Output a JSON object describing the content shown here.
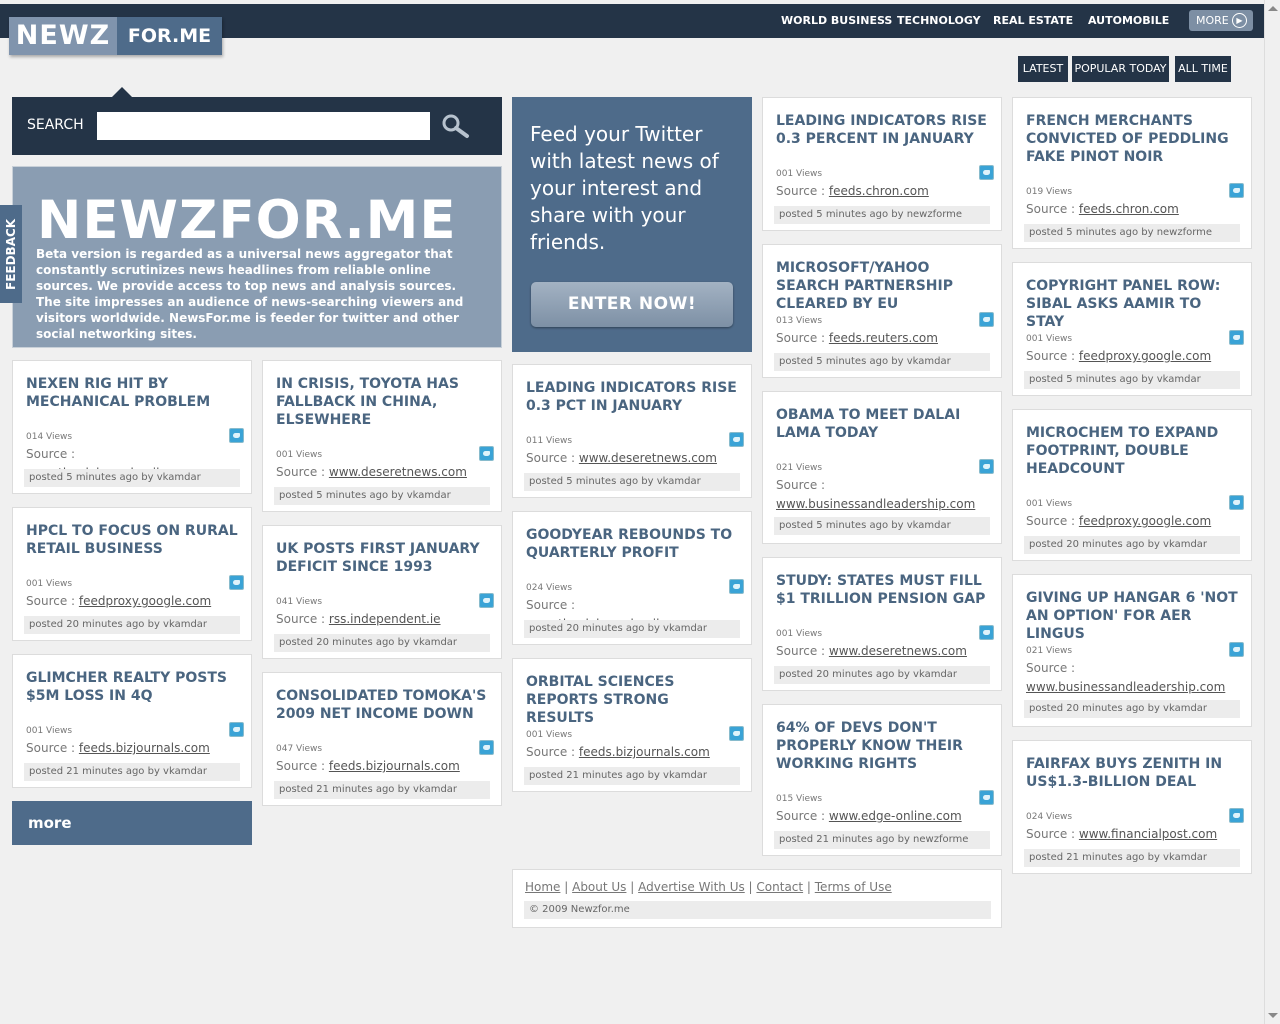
{
  "logo": {
    "part1": "NEWZ",
    "part2": "FOR.ME"
  },
  "nav": {
    "items": [
      "WORLD BUSINESS",
      "TECHNOLOGY",
      "REAL ESTATE",
      "AUTOMOBILE"
    ],
    "more_label": "MORE"
  },
  "filters": [
    "LATEST",
    "POPULAR TODAY",
    "ALL TIME"
  ],
  "search": {
    "label": "SEARCH",
    "placeholder": ""
  },
  "intro": {
    "title": "NEWZFOR.ME",
    "body": "Beta version is regarded as a universal news aggregator that constantly scrutinizes news headlines from reliable online sources. We provide access to top news and analysis sources. The site impresses an audience of news-searching viewers and visitors worldwide. NewsFor.me is feeder for twitter and other social networking sites."
  },
  "feedback_label": "FEEDBACK",
  "promo": {
    "text": "Feed your Twitter with latest news of your interest and share with your friends.",
    "button": "ENTER NOW!"
  },
  "more_panel_label": "more",
  "cards": [
    {
      "title": "NEXEN RIG HIT BY MECHANICAL PROBLEM",
      "views": "014 Views",
      "source_prefix": "Source : ",
      "source": "www.theglobeandmail.com",
      "posted": "posted 5 minutes ago by vkamdar"
    },
    {
      "title": "HPCL TO FOCUS ON RURAL RETAIL BUSINESS",
      "views": "001 Views",
      "source_prefix": "Source : ",
      "source": "feedproxy.google.com",
      "posted": "posted 20 minutes ago by vkamdar"
    },
    {
      "title": "GLIMCHER REALTY POSTS $5M LOSS IN 4Q",
      "views": "001 Views",
      "source_prefix": "Source : ",
      "source": "feeds.bizjournals.com",
      "posted": "posted 21 minutes ago by vkamdar"
    },
    {
      "title": "IN CRISIS, TOYOTA HAS FALLBACK IN CHINA, ELSEWHERE",
      "views": "001 Views",
      "source_prefix": "Source : ",
      "source": "www.deseretnews.com",
      "posted": "posted 5 minutes ago by vkamdar"
    },
    {
      "title": "UK POSTS FIRST JANUARY DEFICIT SINCE 1993",
      "views": "041 Views",
      "source_prefix": "Source : ",
      "source": "rss.independent.ie",
      "posted": "posted 20 minutes ago by vkamdar"
    },
    {
      "title": "CONSOLIDATED TOMOKA'S 2009 NET INCOME DOWN",
      "views": "047 Views",
      "source_prefix": "Source : ",
      "source": "feeds.bizjournals.com",
      "posted": "posted 21 minutes ago by vkamdar"
    },
    {
      "title": "LEADING INDICATORS RISE 0.3 PCT IN JANUARY",
      "views": "011 Views",
      "source_prefix": "Source : ",
      "source": "www.deseretnews.com",
      "posted": "posted 5 minutes ago by vkamdar"
    },
    {
      "title": "GOODYEAR REBOUNDS TO QUARTERLY PROFIT",
      "views": "024 Views",
      "source_prefix": "Source : ",
      "source": "www.theglobeandmail.com",
      "posted": "posted 20 minutes ago by vkamdar"
    },
    {
      "title": "ORBITAL SCIENCES REPORTS STRONG RESULTS",
      "views": "001 Views",
      "source_prefix": "Source : ",
      "source": "feeds.bizjournals.com",
      "posted": "posted 21 minutes ago by vkamdar"
    },
    {
      "title": "LEADING INDICATORS RISE 0.3 PERCENT IN JANUARY",
      "views": "001 Views",
      "source_prefix": "Source : ",
      "source": "feeds.chron.com",
      "posted": "posted 5 minutes ago by newzforme"
    },
    {
      "title": "MICROSOFT/YAHOO SEARCH PARTNERSHIP CLEARED BY EU",
      "views": "013 Views",
      "source_prefix": "Source : ",
      "source": "feeds.reuters.com",
      "posted": "posted 5 minutes ago by vkamdar"
    },
    {
      "title": "OBAMA TO MEET DALAI LAMA TODAY",
      "views": "021 Views",
      "source_prefix": "Source :",
      "source": "www.businessandleadership.com",
      "posted": "posted 5 minutes ago by vkamdar"
    },
    {
      "title": "STUDY: STATES MUST FILL $1 TRILLION PENSION GAP",
      "views": "001 Views",
      "source_prefix": "Source : ",
      "source": "www.deseretnews.com",
      "posted": "posted 20 minutes ago by vkamdar"
    },
    {
      "title": "64% OF DEVS DON'T PROPERLY KNOW THEIR WORKING RIGHTS",
      "views": "015 Views",
      "source_prefix": "Source : ",
      "source": "www.edge-online.com",
      "posted": "posted 21 minutes ago by newzforme"
    },
    {
      "title": "FRENCH MERCHANTS CONVICTED OF PEDDLING FAKE PINOT NOIR",
      "views": "019 Views",
      "source_prefix": "Source : ",
      "source": "feeds.chron.com",
      "posted": "posted 5 minutes ago by newzforme"
    },
    {
      "title": "COPYRIGHT PANEL ROW: SIBAL ASKS AAMIR TO STAY",
      "views": "001 Views",
      "source_prefix": "Source : ",
      "source": "feedproxy.google.com",
      "posted": "posted 5 minutes ago by vkamdar"
    },
    {
      "title": "MICROCHEM TO EXPAND FOOTPRINT, DOUBLE HEADCOUNT",
      "views": "001 Views",
      "source_prefix": "Source : ",
      "source": "feedproxy.google.com",
      "posted": "posted 20 minutes ago by vkamdar"
    },
    {
      "title": "GIVING UP HANGAR 6 'NOT AN OPTION' FOR AER LINGUS",
      "views": "021 Views",
      "source_prefix": "Source :",
      "source": "www.businessandleadership.com",
      "posted": "posted 20 minutes ago by vkamdar"
    },
    {
      "title": "FAIRFAX BUYS ZENITH IN US$1.3-BILLION DEAL",
      "views": "024 Views",
      "source_prefix": "Source : ",
      "source": "www.financialpost.com",
      "posted": "posted 21 minutes ago by vkamdar"
    }
  ],
  "footer": {
    "links": [
      "Home",
      "About Us",
      "Advertise With Us",
      "Contact",
      "Terms of Use"
    ],
    "copyright": "© 2009 Newzfor.me"
  }
}
